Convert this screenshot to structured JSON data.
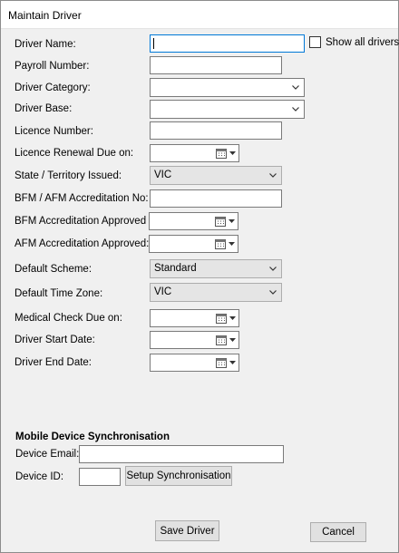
{
  "window": {
    "title": "Maintain Driver"
  },
  "form": {
    "driver_name_label": "Driver Name:",
    "driver_name_value": "",
    "show_all_label": "Show all drivers",
    "payroll_label": "Payroll Number:",
    "payroll_value": "",
    "category_label": "Driver Category:",
    "category_value": "",
    "base_label": "Driver Base:",
    "base_value": "",
    "licence_number_label": "Licence Number:",
    "licence_number_value": "",
    "licence_renewal_label": "Licence Renewal Due on:",
    "state_label": "State / Territory Issued:",
    "state_value": "VIC",
    "bfm_afm_no_label": "BFM / AFM Accreditation No:",
    "bfm_afm_no_value": "",
    "bfm_approved_label": "BFM Accreditation Approved :",
    "afm_approved_label": "AFM Accreditation Approved:",
    "scheme_label": "Default Scheme:",
    "scheme_value": "Standard",
    "timezone_label": "Default Time Zone:",
    "timezone_value": "VIC",
    "medical_label": "Medical Check Due on:",
    "start_date_label": "Driver Start Date:",
    "end_date_label": "Driver End Date:"
  },
  "mobile": {
    "heading": "Mobile Device Synchronisation",
    "email_label": "Device Email:",
    "email_value": "",
    "device_id_label": "Device ID:",
    "device_id_value": "",
    "setup_button": "Setup Synchronisation"
  },
  "actions": {
    "save_button": "Save Driver",
    "cancel_button": "Cancel"
  },
  "icons": {
    "dropdown": "chevron-down-icon",
    "calendar": "calendar-icon"
  },
  "colors": {
    "focus_border": "#0078d7",
    "dialog_background": "#f0f0f0",
    "button_face": "#e1e1e1"
  }
}
